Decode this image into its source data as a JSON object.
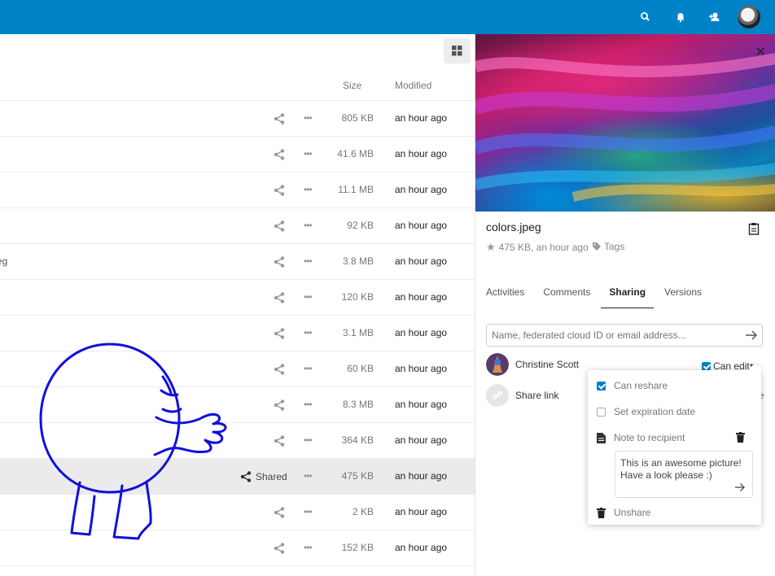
{
  "header": {
    "icons": [
      "search-icon",
      "bell-icon",
      "contacts-icon"
    ],
    "bg_color": "#0082c9"
  },
  "files": {
    "columns": {
      "size": "Size",
      "modified": "Modified"
    },
    "rows": [
      {
        "name": "",
        "size": "805 KB",
        "modified": "an hour ago",
        "shared": false
      },
      {
        "name": "",
        "size": "41.6 MB",
        "modified": "an hour ago",
        "shared": false
      },
      {
        "name": "",
        "size": "11.1 MB",
        "modified": "an hour ago",
        "shared": false
      },
      {
        "name": "",
        "size": "92 KB",
        "modified": "an hour ago",
        "shared": false
      },
      {
        "name": "eg",
        "size": "3.8 MB",
        "modified": "an hour ago",
        "shared": false
      },
      {
        "name": "",
        "size": "120 KB",
        "modified": "an hour ago",
        "shared": false
      },
      {
        "name": "",
        "size": "3.1 MB",
        "modified": "an hour ago",
        "shared": false
      },
      {
        "name": "",
        "size": "60 KB",
        "modified": "an hour ago",
        "shared": false
      },
      {
        "name": "",
        "size": "8.3 MB",
        "modified": "an hour ago",
        "shared": false
      },
      {
        "name": "",
        "size": "364 KB",
        "modified": "an hour ago",
        "shared": false
      },
      {
        "name": "",
        "size": "475 KB",
        "modified": "an hour ago",
        "shared": true,
        "shared_label": "Shared"
      },
      {
        "name": "",
        "size": "2 KB",
        "modified": "an hour ago",
        "shared": false
      },
      {
        "name": "",
        "size": "152 KB",
        "modified": "an hour ago",
        "shared": false
      }
    ]
  },
  "sidebar": {
    "filename": "colors.jpeg",
    "meta": "475 KB, an hour ago",
    "tags_label": "Tags",
    "tabs": [
      "Activities",
      "Comments",
      "Sharing",
      "Versions"
    ],
    "active_tab": "Sharing",
    "share_placeholder": "Name, federated cloud ID or email address...",
    "sharee": {
      "name": "Christine Scott",
      "can_edit_label": "Can edit",
      "can_edit": true
    },
    "share_link_label": "Share link",
    "trailing_text": "e"
  },
  "popover": {
    "can_reshare_label": "Can reshare",
    "can_reshare": true,
    "expiration_label": "Set expiration date",
    "expiration": false,
    "note_label": "Note to recipient",
    "note_text": "This is an awesome picture! Have a look please :)",
    "unshare_label": "Unshare"
  }
}
